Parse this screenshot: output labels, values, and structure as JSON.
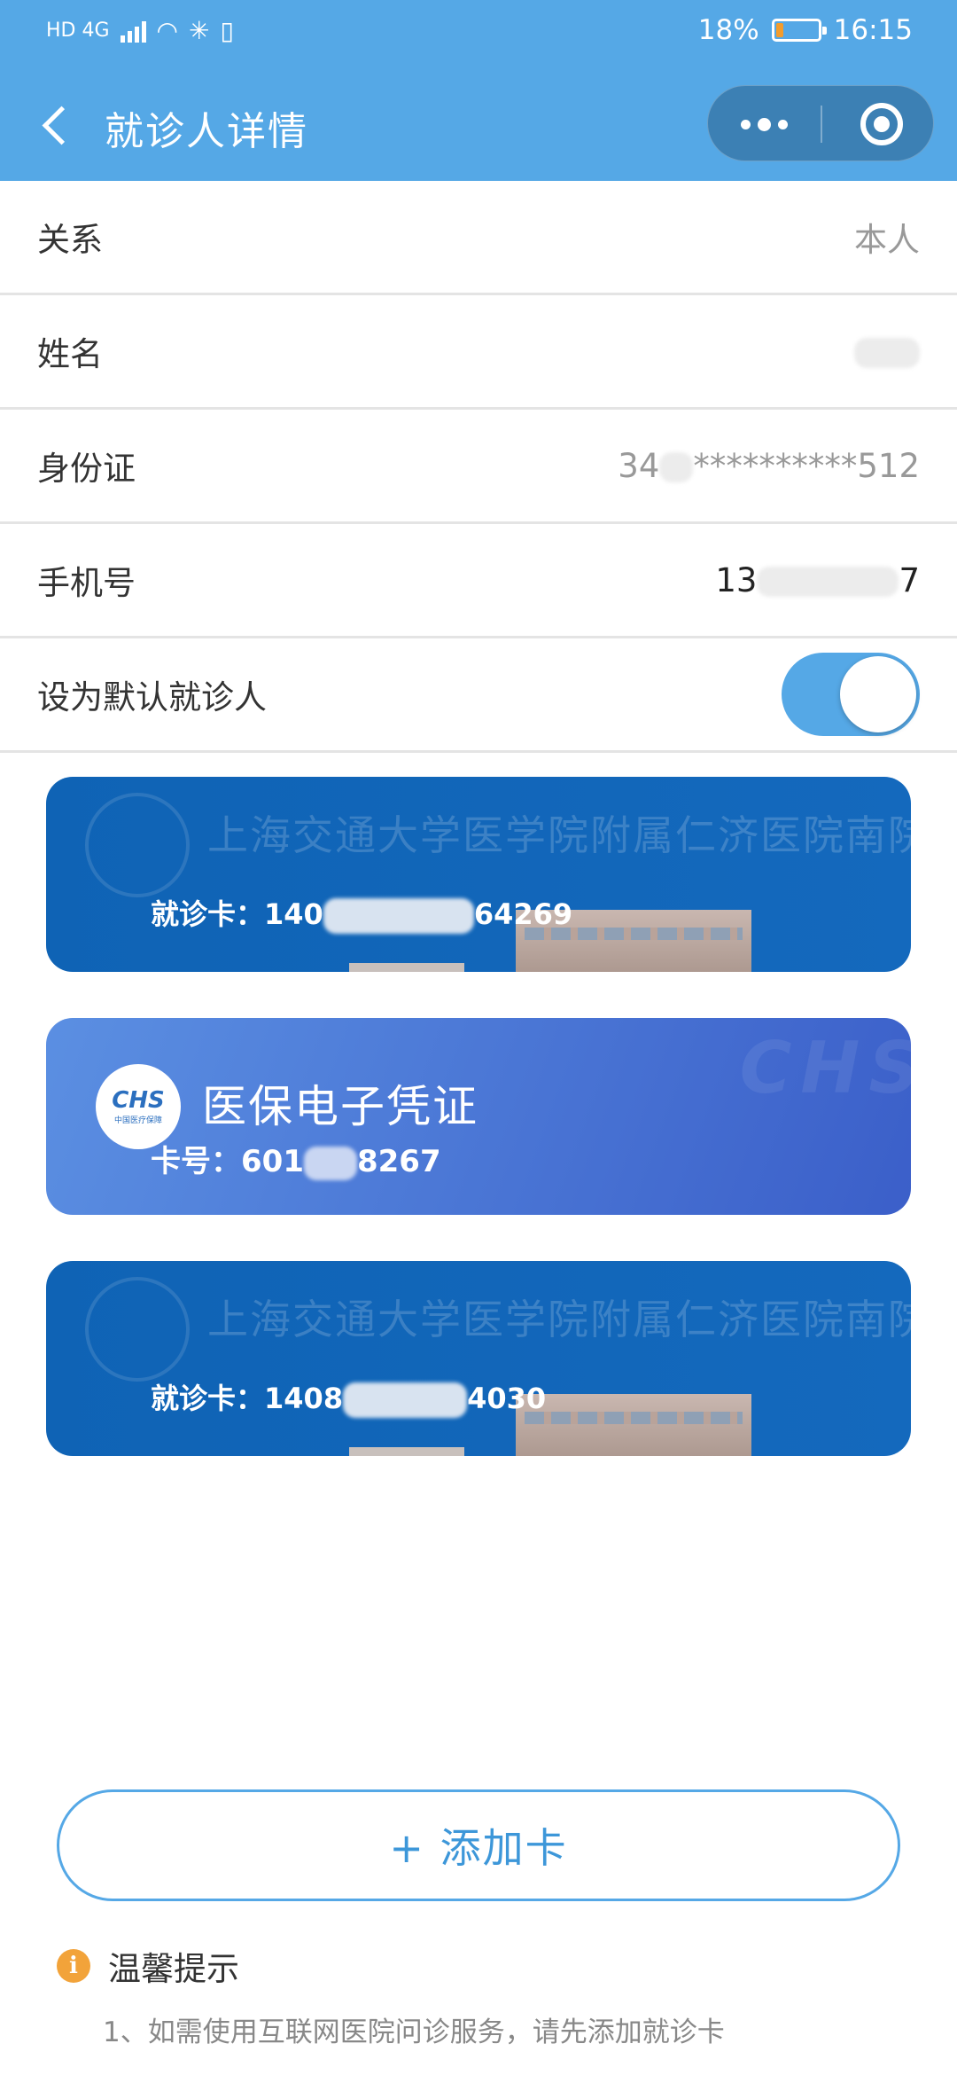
{
  "status_bar": {
    "left_indicators": "HD 4G",
    "battery_percent": "18%",
    "time": "16:15",
    "battery_fill": 0.18,
    "battery_color": "#f39c2c"
  },
  "nav": {
    "title": "就诊人详情",
    "back_icon": "chevron-left-icon",
    "more_icon": "more-dots-icon",
    "close_icon": "target-circle-icon"
  },
  "rows": [
    {
      "label": "关系",
      "value": "本人"
    },
    {
      "label": "姓名",
      "value": ""
    },
    {
      "label": "身份证",
      "value_prefix": "34",
      "value_suffix": "**********512"
    },
    {
      "label": "手机号",
      "value_prefix": "13",
      "value_suffix": "7"
    },
    {
      "label": "设为默认就诊人",
      "toggle_on": true
    }
  ],
  "cards": [
    {
      "type": "hospital",
      "watermark": "上海交通大学医学院附属仁济医院南院",
      "label": "就诊卡：",
      "number_prefix": "140",
      "number_suffix": "64269"
    },
    {
      "type": "insurance",
      "logo_text": "CHS",
      "logo_sub": "中国医疗保障",
      "title": "医保电子凭证",
      "label": "卡号：",
      "number_prefix": "601",
      "number_suffix": "8267"
    },
    {
      "type": "hospital",
      "watermark": "上海交通大学医学院附属仁济医院南院",
      "label": "就诊卡：",
      "number_prefix": "1408",
      "number_suffix": "4030"
    }
  ],
  "add_button": {
    "label": "+ 添加卡"
  },
  "tips": {
    "title": "温馨提示",
    "lines": [
      "1、如需使用互联网医院问诊服务，请先添加就诊卡"
    ]
  },
  "colors": {
    "primary": "#55a8e6",
    "hospital_card": "#1469bd",
    "insurance_card": "#4a76d6",
    "tip_icon": "#f2a33a"
  }
}
